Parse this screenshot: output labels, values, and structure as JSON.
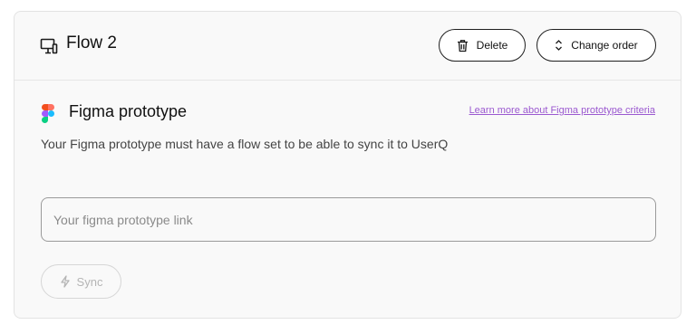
{
  "flow": {
    "title": "Flow 2",
    "icon": "monitor-icon"
  },
  "header_actions": {
    "delete_label": "Delete",
    "delete_icon": "trash-icon",
    "change_order_label": "Change order",
    "change_order_icon": "chevron-up-down-icon"
  },
  "figma_section": {
    "title": "Figma prototype",
    "logo": "figma-logo",
    "learn_more_link": "Learn more about Figma prototype criteria",
    "description": "Your Figma prototype must have a flow set to be able to sync it to UserQ",
    "link_input": {
      "value": "",
      "placeholder": "Your figma prototype link"
    },
    "sync_button": {
      "label": "Sync",
      "icon": "lightning-icon",
      "disabled": true
    }
  },
  "colors": {
    "link": "#9b59d0",
    "card_background": "#f9f9f9",
    "button_border": "#1f1f1f",
    "disabled_text": "#b5b5b5"
  }
}
